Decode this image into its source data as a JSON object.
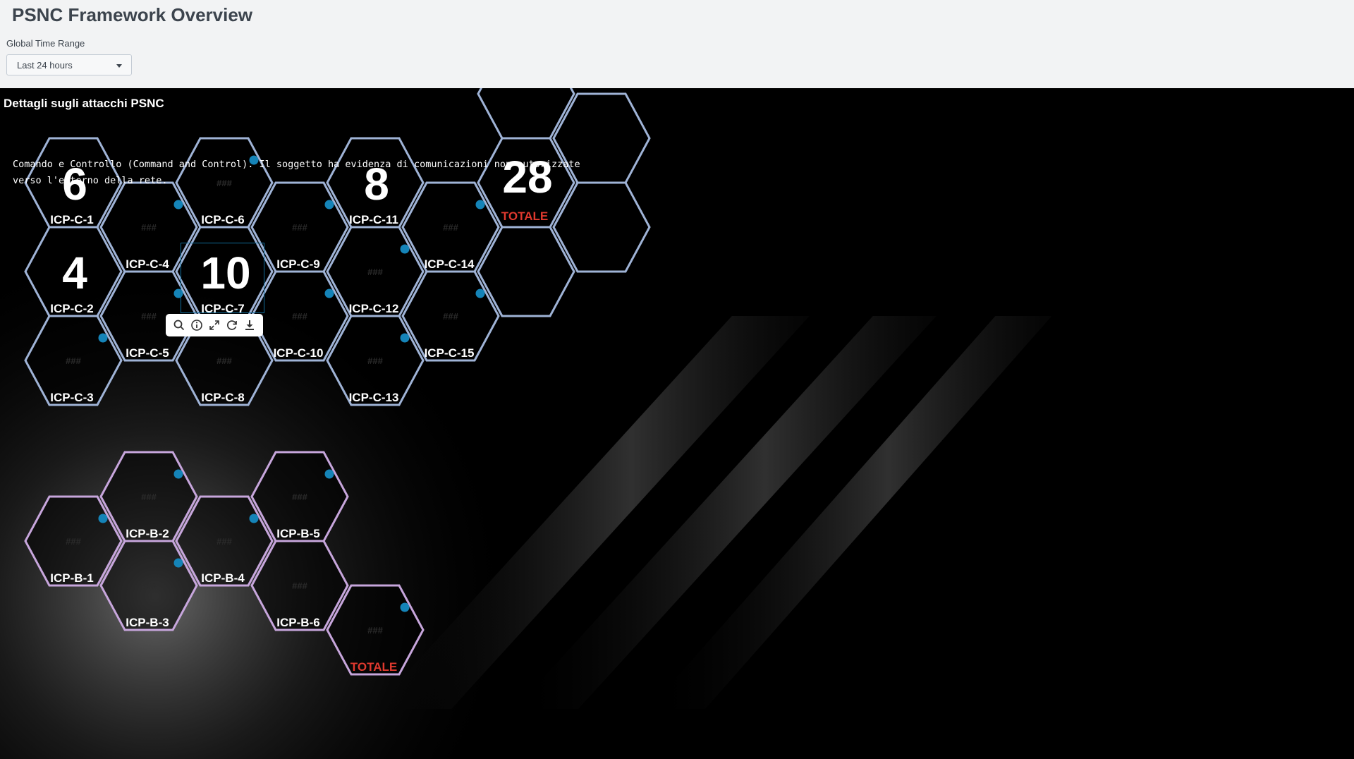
{
  "page": {
    "title": "PSNC Framework Overview",
    "time_label": "Global Time Range",
    "time_value": "Last 24 hours"
  },
  "panel": {
    "title": "Dettagli sugli attacchi PSNC",
    "description": "Comando e Controllo (Command and Control). Il soggetto ha evidenza di comunicazioni non autorizzate verso l'esterno della rete."
  },
  "toolbar": {
    "icons": [
      "search-icon",
      "info-icon",
      "expand-icon",
      "refresh-icon",
      "download-icon"
    ]
  },
  "placeholder": "###",
  "group_c": [
    {
      "label": "ICP-C-1",
      "value": "6"
    },
    {
      "label": "ICP-C-2",
      "value": "4"
    },
    {
      "label": "ICP-C-3",
      "value": ""
    },
    {
      "label": "ICP-C-4",
      "value": ""
    },
    {
      "label": "ICP-C-5",
      "value": ""
    },
    {
      "label": "ICP-C-6",
      "value": ""
    },
    {
      "label": "ICP-C-7",
      "value": "10"
    },
    {
      "label": "ICP-C-8",
      "value": ""
    },
    {
      "label": "ICP-C-9",
      "value": ""
    },
    {
      "label": "ICP-C-10",
      "value": ""
    },
    {
      "label": "ICP-C-11",
      "value": "8"
    },
    {
      "label": "ICP-C-12",
      "value": ""
    },
    {
      "label": "ICP-C-13",
      "value": ""
    },
    {
      "label": "ICP-C-14",
      "value": ""
    },
    {
      "label": "ICP-C-15",
      "value": ""
    },
    {
      "label": "TOTALE",
      "value": "28"
    }
  ],
  "group_b": [
    {
      "label": "ICP-B-1",
      "value": ""
    },
    {
      "label": "ICP-B-2",
      "value": ""
    },
    {
      "label": "ICP-B-3",
      "value": ""
    },
    {
      "label": "ICP-B-4",
      "value": ""
    },
    {
      "label": "ICP-B-5",
      "value": ""
    },
    {
      "label": "ICP-B-6",
      "value": ""
    },
    {
      "label": "TOTALE",
      "value": ""
    }
  ],
  "colors": {
    "stroke_c": "#9fb3d6",
    "stroke_b": "#c7a6dc",
    "dot": "#1584b8",
    "total": "#e0392e",
    "topbar": "#f2f3f4"
  }
}
